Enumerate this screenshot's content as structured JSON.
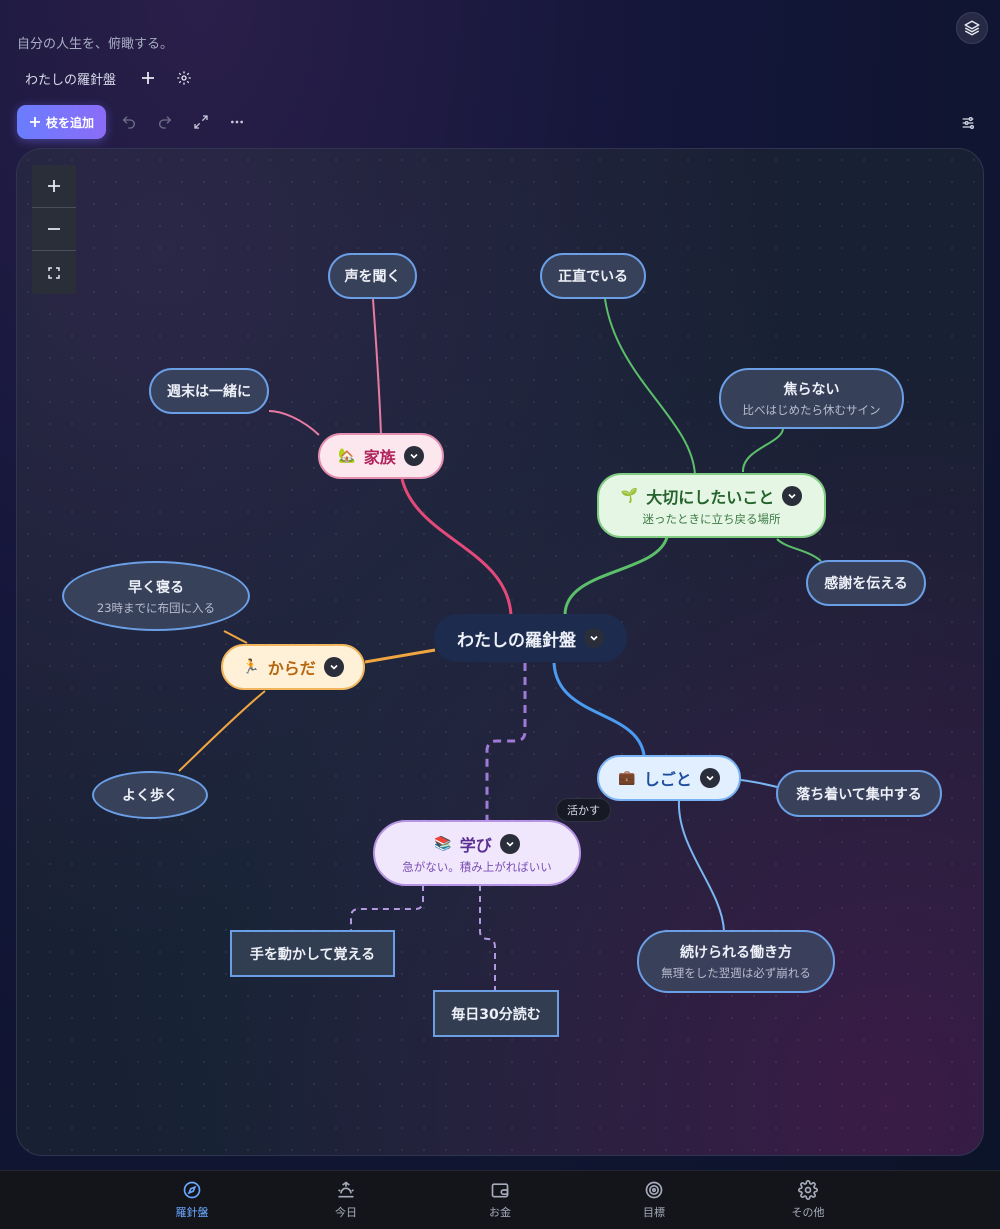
{
  "header": {
    "tagline": "自分の人生を、俯瞰する。",
    "map_tab": "わたしの羅針盤"
  },
  "toolbar": {
    "add_branch_label": "枝を追加"
  },
  "colors": {
    "accent": "#6a7dff",
    "family": "#e34a7a",
    "values": "#5cbf6a",
    "body": "#f0a640",
    "work": "#4b9cf0",
    "learn": "#a07ad8",
    "nav_active": "#6aa8ff"
  },
  "map": {
    "root": {
      "title": "わたしの羅針盤"
    },
    "family": {
      "icon": "house-icon",
      "title": "家族",
      "children": [
        "声を聞く",
        "週末は一緒に"
      ]
    },
    "values": {
      "icon": "seedling-icon",
      "title": "大切にしたいこと",
      "subtitle": "迷ったときに立ち戻る場所",
      "children": [
        {
          "title": "正直でいる"
        },
        {
          "title": "焦らない",
          "subtitle": "比べはじめたら休むサイン"
        },
        {
          "title": "感謝を伝える"
        }
      ]
    },
    "body": {
      "icon": "runner-icon",
      "title": "からだ",
      "children": [
        {
          "title": "早く寝る",
          "subtitle": "23時までに布団に入る"
        },
        {
          "title": "よく歩く"
        }
      ]
    },
    "work": {
      "icon": "briefcase-icon",
      "title": "しごと",
      "children": [
        {
          "title": "落ち着いて集中する"
        },
        {
          "title": "続けられる働き方",
          "subtitle": "無理をした翌週は必ず崩れる"
        }
      ]
    },
    "learn": {
      "icon": "books-icon",
      "title": "学び",
      "subtitle": "急がない。積み上がればいい",
      "children": [
        "手を動かして覚える",
        "毎日30分読む"
      ],
      "link_label": "活かす"
    }
  },
  "nav": {
    "items": [
      {
        "label": "羅針盤",
        "icon": "compass-icon",
        "active": true
      },
      {
        "label": "今日",
        "icon": "sunrise-icon",
        "active": false
      },
      {
        "label": "お金",
        "icon": "wallet-icon",
        "active": false
      },
      {
        "label": "目標",
        "icon": "target-icon",
        "active": false
      },
      {
        "label": "その他",
        "icon": "gear-icon",
        "active": false
      }
    ]
  }
}
